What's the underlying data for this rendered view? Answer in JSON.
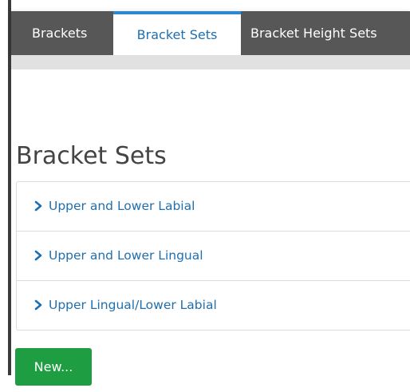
{
  "tabs": [
    {
      "label": "Brackets",
      "active": false
    },
    {
      "label": "Bracket Sets",
      "active": true
    },
    {
      "label": "Bracket Height Sets",
      "active": false
    }
  ],
  "page": {
    "title": "Bracket Sets"
  },
  "bracket_sets": [
    {
      "label": "Upper and Lower Labial"
    },
    {
      "label": "Upper and Lower Lingual"
    },
    {
      "label": "Upper Lingual/Lower Labial"
    }
  ],
  "actions": {
    "new_label": "New..."
  },
  "colors": {
    "accent_blue": "#1f6fae",
    "tab_bar": "#575757",
    "new_button": "#1f9d43"
  },
  "icons": {
    "list_item": "chevron-right-icon"
  }
}
